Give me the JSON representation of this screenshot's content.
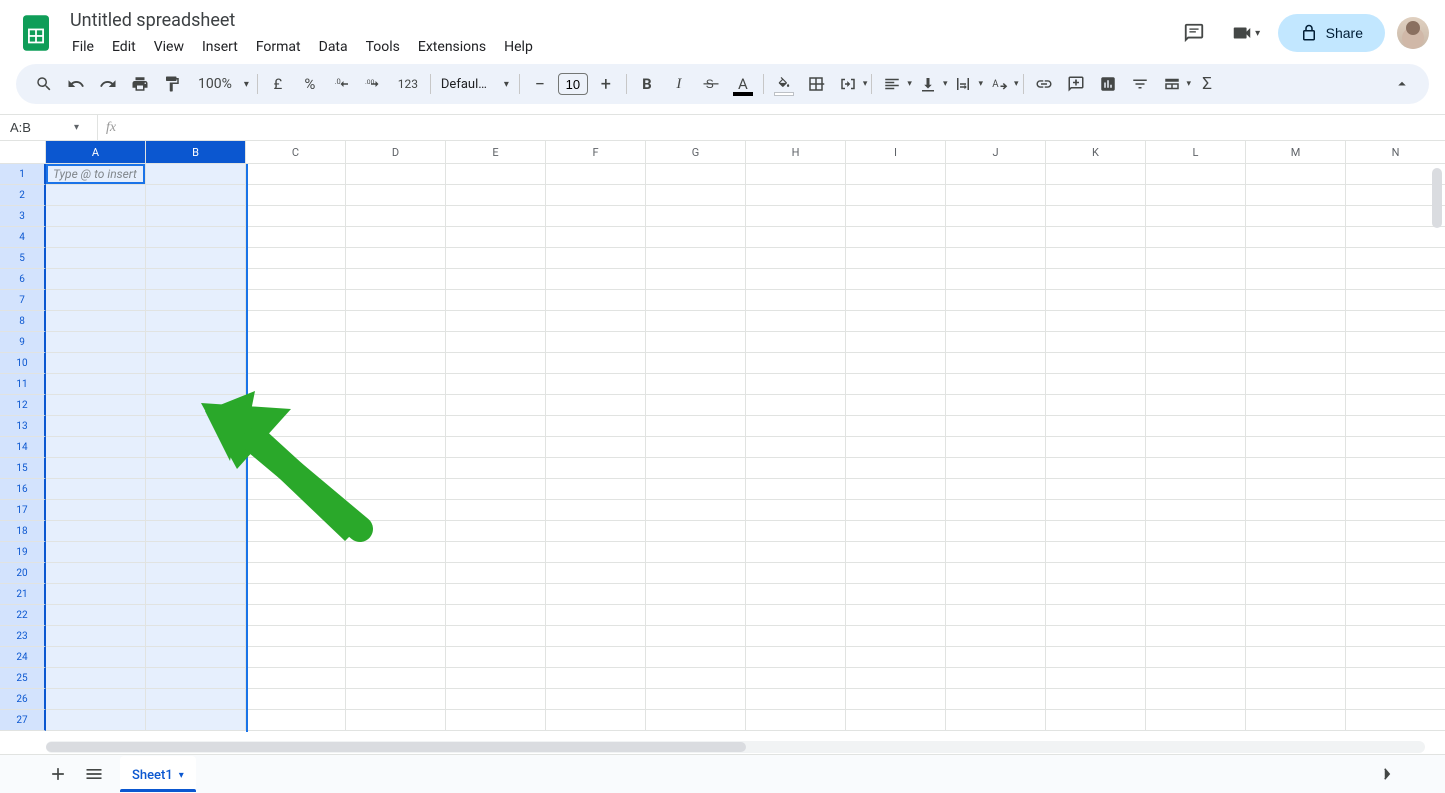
{
  "doc": {
    "title": "Untitled spreadsheet"
  },
  "menus": [
    "File",
    "Edit",
    "View",
    "Insert",
    "Format",
    "Data",
    "Tools",
    "Extensions",
    "Help"
  ],
  "share_label": "Share",
  "toolbar": {
    "zoom": "100%",
    "font": "Defaul…",
    "font_size": "10",
    "currency_code": "£",
    "percent": "%",
    "number_auto": "123"
  },
  "name_box": "A:B",
  "hint": "Type @ to insert",
  "columns": [
    "A",
    "B",
    "C",
    "D",
    "E",
    "F",
    "G",
    "H",
    "I",
    "J",
    "K",
    "L",
    "M",
    "N"
  ],
  "selected_cols": [
    "A",
    "B"
  ],
  "row_count": 27,
  "sheet_tab": "Sheet1"
}
